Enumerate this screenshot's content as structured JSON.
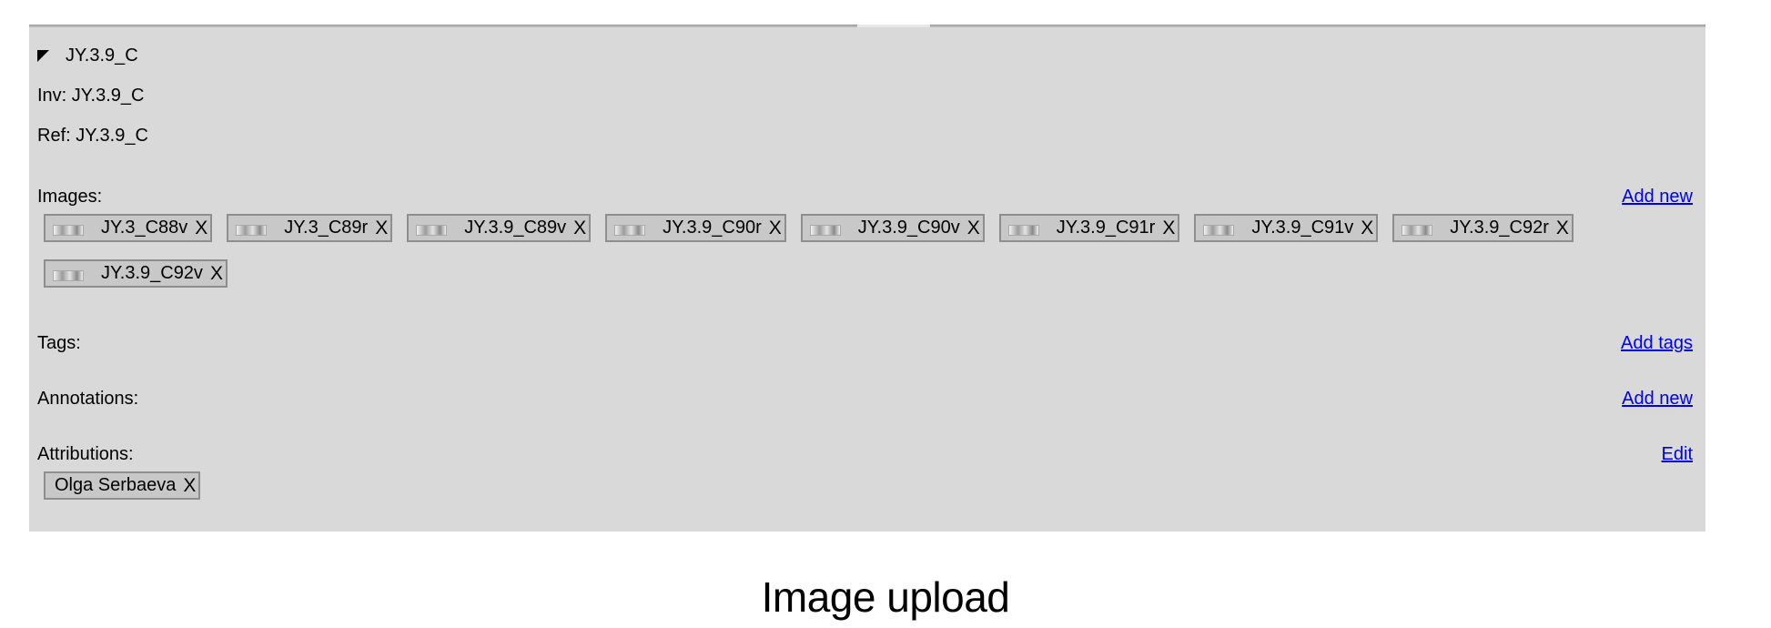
{
  "record": {
    "title": "JY.3.9_C",
    "inv": "Inv: JY.3.9_C",
    "ref": "Ref: JY.3.9_C"
  },
  "images": {
    "label": "Images:",
    "add_label": "Add new",
    "remove_label": "X",
    "thumbnail_icon": "image-thumbnail-icon",
    "items": [
      "JY.3_C88v",
      "JY.3_C89r",
      "JY.3.9_C89v",
      "JY.3.9_C90r",
      "JY.3.9_C90v",
      "JY.3.9_C91r",
      "JY.3.9_C91v",
      "JY.3.9_C92r",
      "JY.3.9_C92v"
    ]
  },
  "tags": {
    "label": "Tags:",
    "add_label": "Add tags"
  },
  "annotations": {
    "label": "Annotations:",
    "add_label": "Add new"
  },
  "attributions": {
    "label": "Attributions:",
    "edit_label": "Edit",
    "items": [
      "Olga Serbaeva"
    ],
    "remove_label": "X"
  },
  "caption": "Image upload",
  "colors": {
    "panel": "#d9d9d9",
    "chip": "#c8c8c8",
    "link": "#0000ee"
  }
}
